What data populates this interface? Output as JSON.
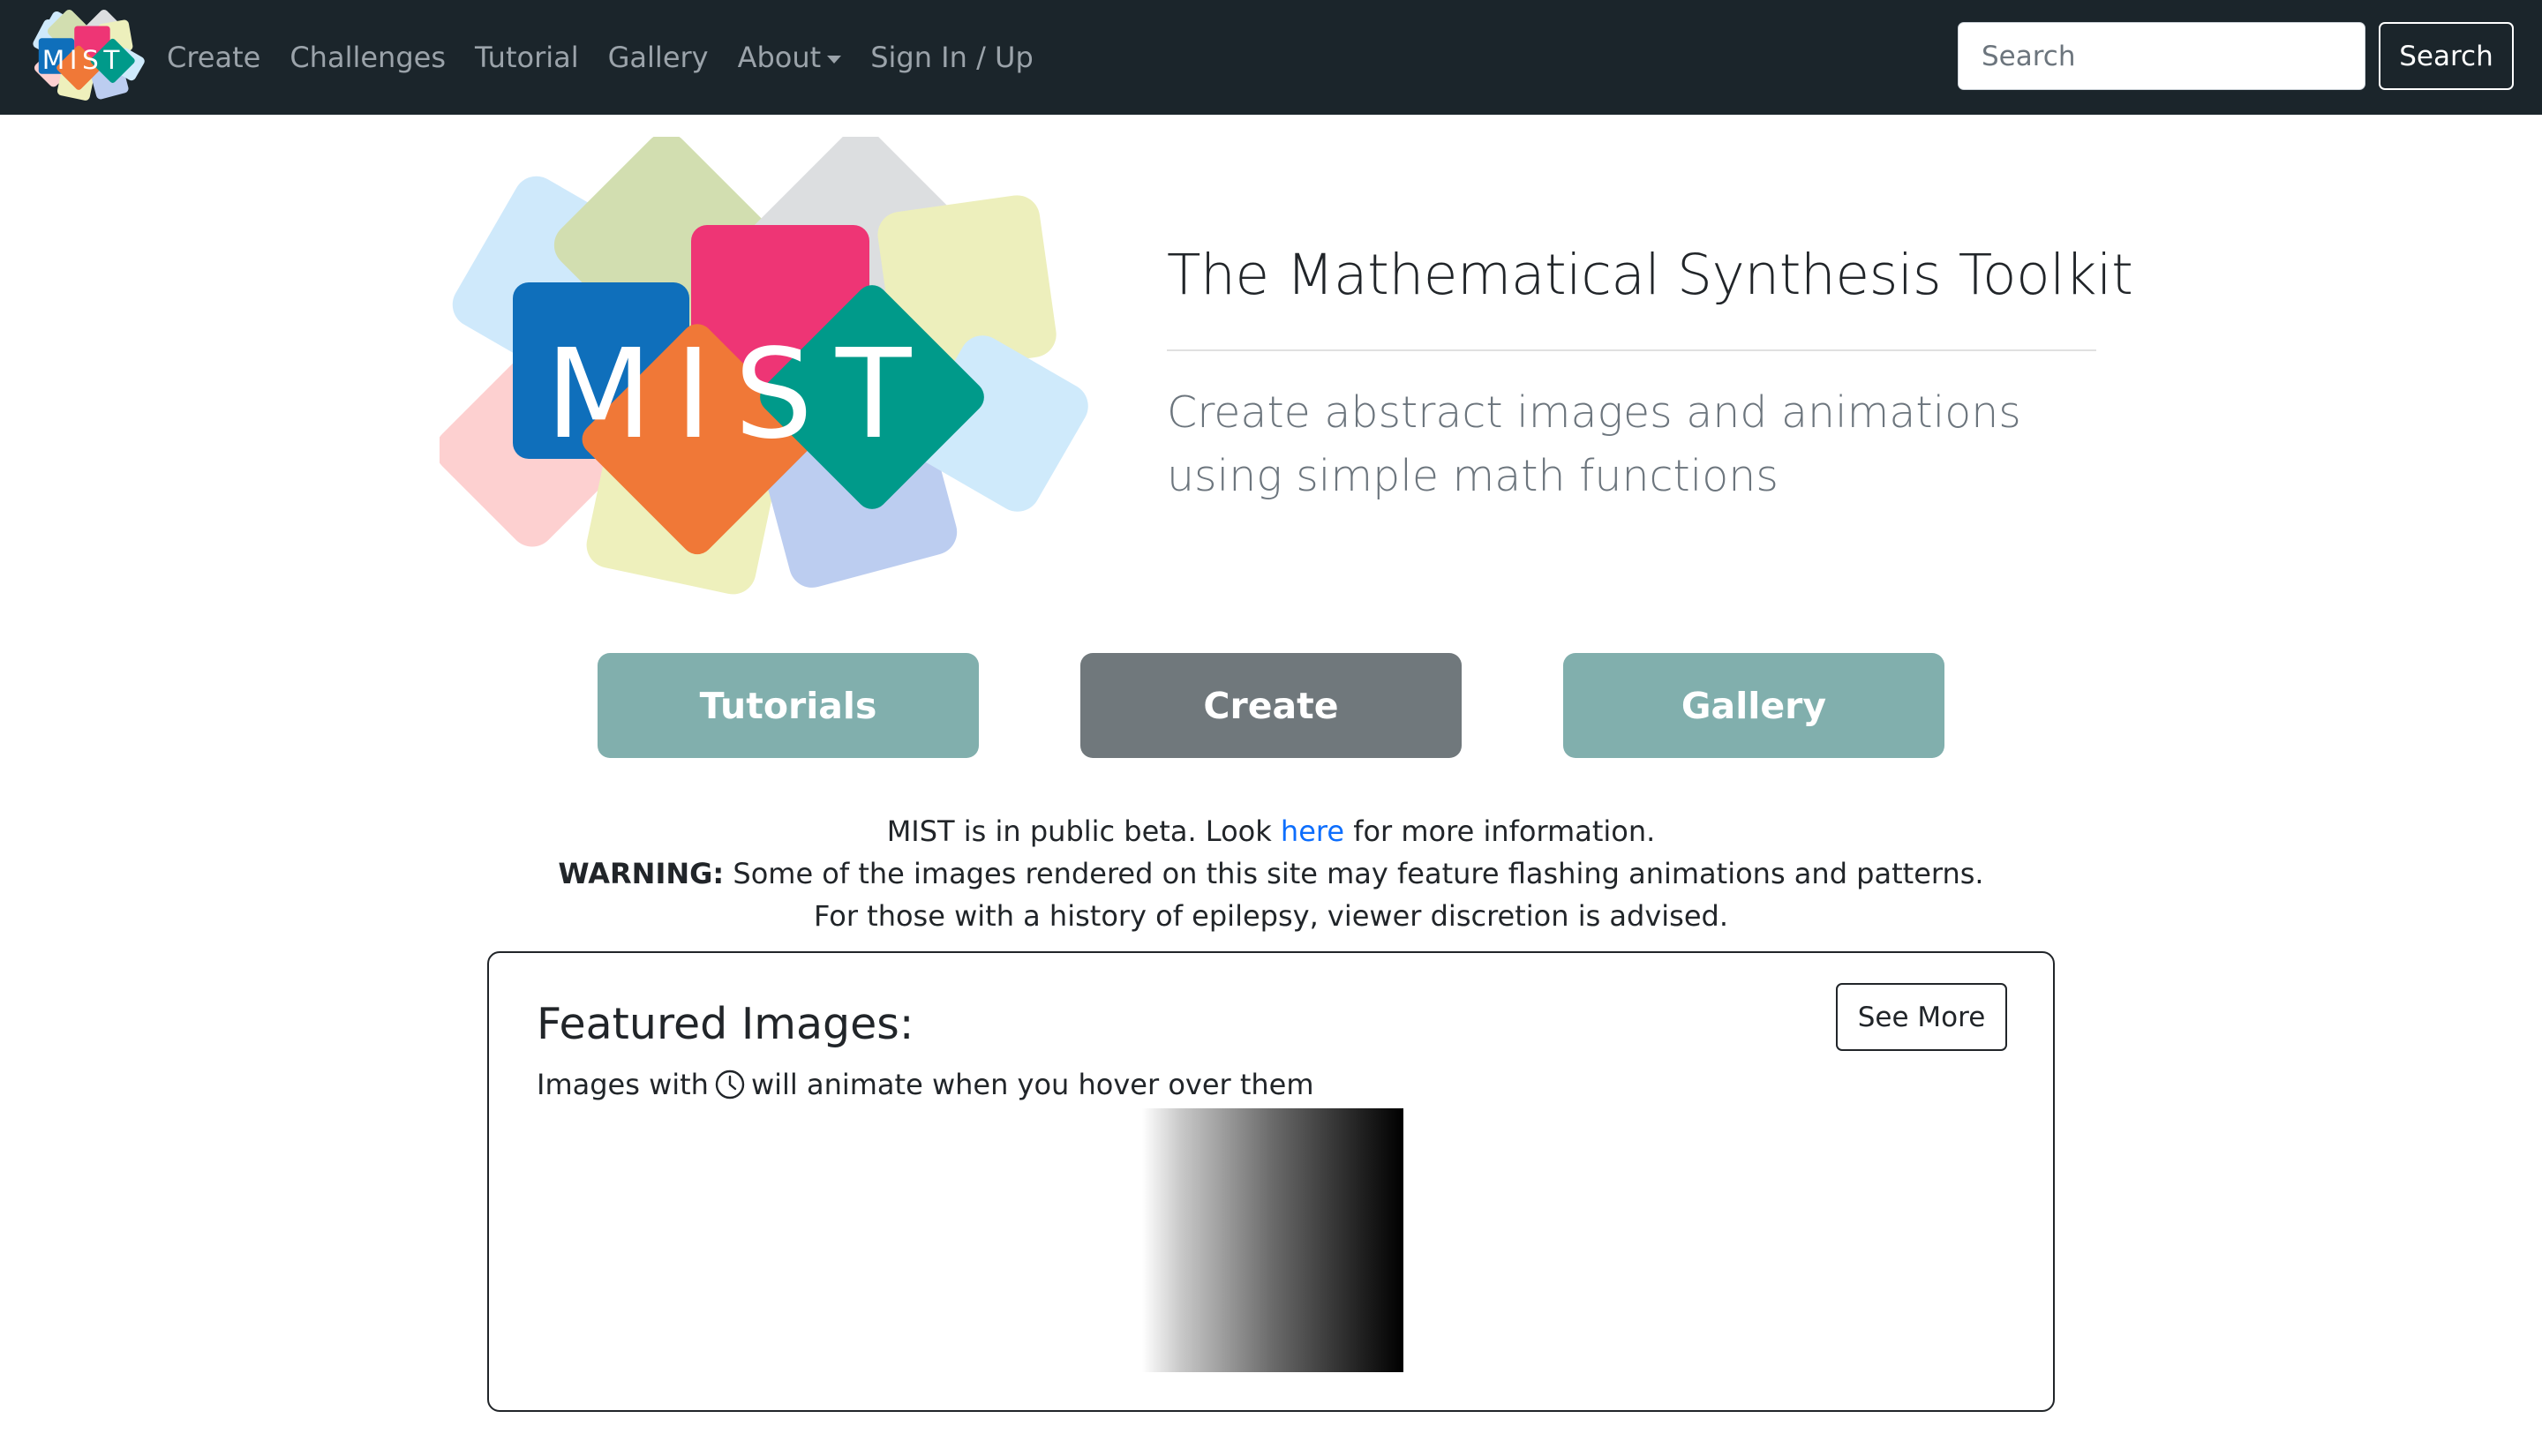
{
  "navbar": {
    "brand_logo_text": "MIST",
    "links": [
      {
        "label": "Create"
      },
      {
        "label": "Challenges"
      },
      {
        "label": "Tutorial"
      },
      {
        "label": "Gallery"
      },
      {
        "label": "About",
        "has_dropdown": true
      },
      {
        "label": "Sign In / Up"
      }
    ],
    "search": {
      "placeholder": "Search",
      "value": "",
      "button_label": "Search"
    }
  },
  "hero": {
    "logo_text": "MIST",
    "title": "The Mathematical Synthesis Toolkit",
    "subtitle_line1": "Create abstract images and animations",
    "subtitle_line2": "using simple math functions"
  },
  "actions": {
    "tutorials_label": "Tutorials",
    "create_label": "Create",
    "gallery_label": "Gallery"
  },
  "notice": {
    "beta_before": "MIST is in public beta. Look ",
    "beta_link": "here",
    "beta_after": " for more information.",
    "warning_label": "WARNING:",
    "warning_text": " Some of the images rendered on this site may feature flashing animations and patterns.",
    "epilepsy_text": "For those with a history of epilepsy, viewer discretion is advised."
  },
  "featured": {
    "title": "Featured Images:",
    "note_before": "Images with ",
    "note_icon": "clock-icon",
    "note_after": " will animate when you hover over them",
    "see_more_label": "See More"
  },
  "colors": {
    "navbar_bg": "#1b252b",
    "teal_button": "#81afad",
    "gray_button": "#70787c",
    "link": "#0d6efd",
    "logo_blue": "#0f6fbb",
    "logo_pink": "#ee3575",
    "logo_orange": "#f07837",
    "logo_green": "#009a8a"
  }
}
